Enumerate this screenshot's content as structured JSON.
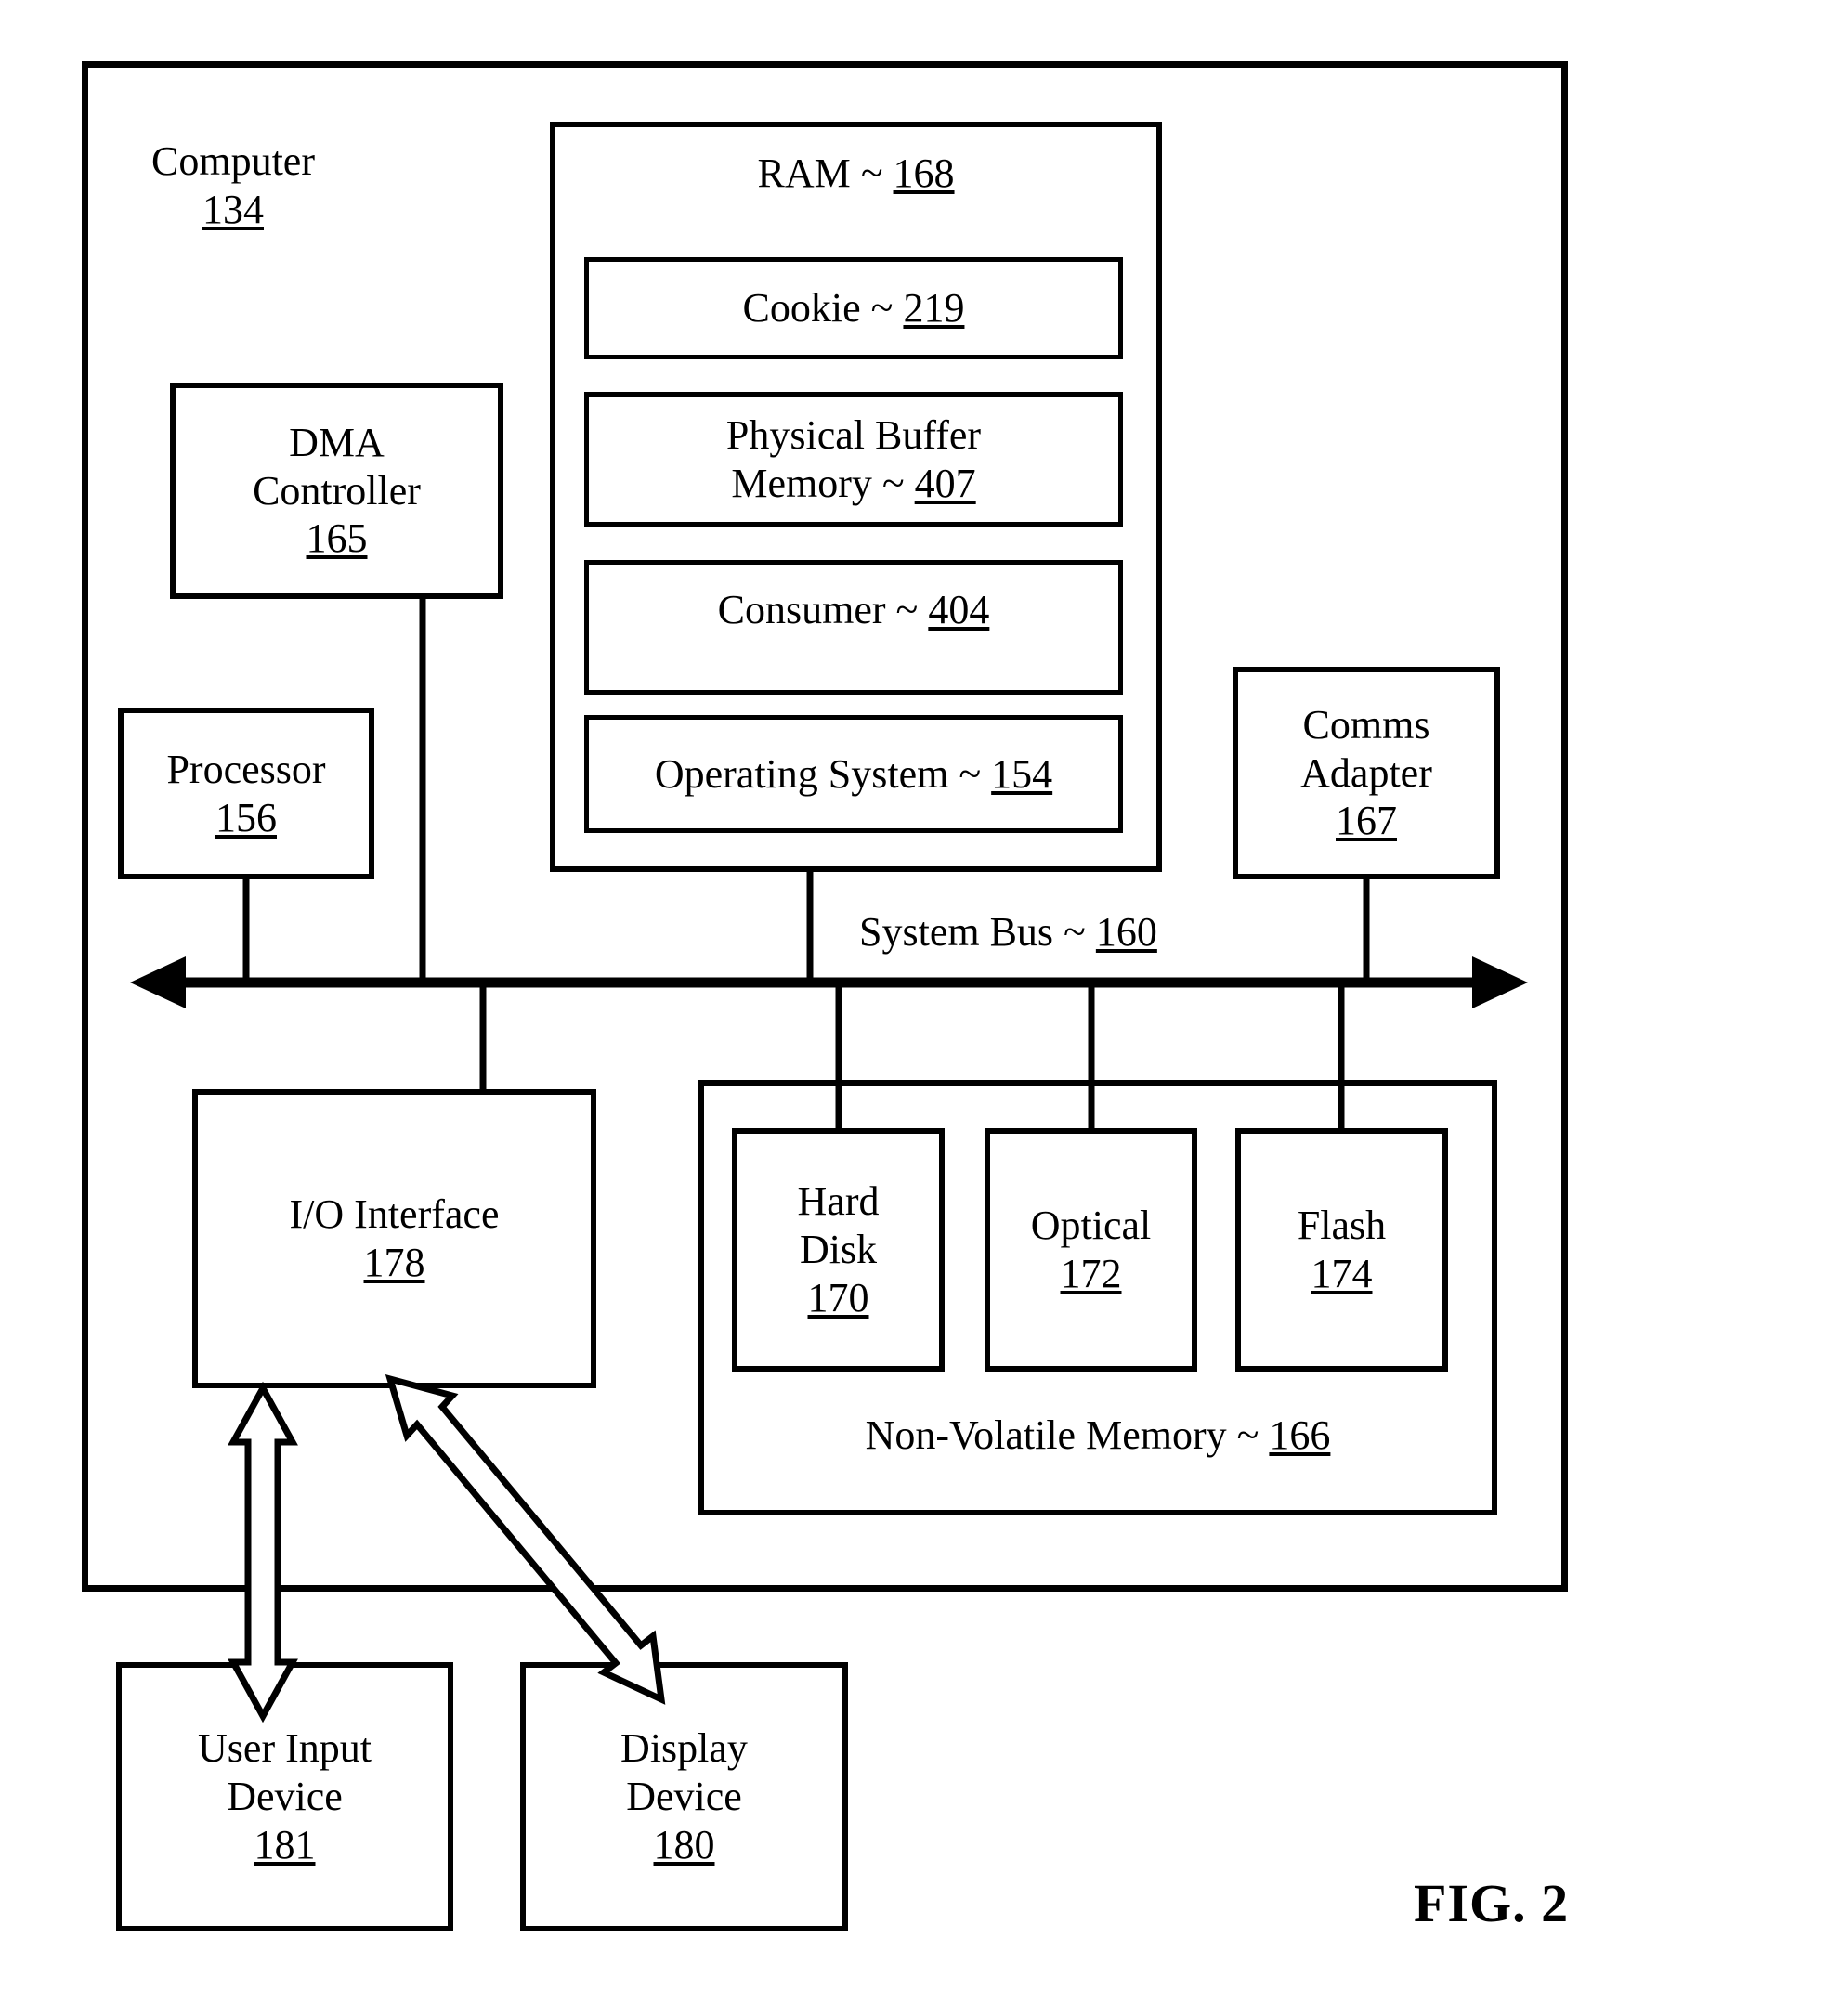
{
  "figure": {
    "label": "FIG. 2",
    "title_block": {
      "name": "Computer",
      "ref": "134"
    }
  },
  "chassis": {
    "name": "computer-chassis"
  },
  "ram": {
    "title_text": "RAM ~ ",
    "title_ref": "168",
    "items": [
      {
        "text": "Cookie ~ ",
        "ref": "219",
        "lines": [
          "Cookie ~ 219"
        ]
      },
      {
        "text": "Physical Buffer",
        "text2": "Memory ~ ",
        "ref": "407"
      },
      {
        "text": "Consumer ~ ",
        "ref": "404"
      },
      {
        "text": "Operating System ~ ",
        "ref": "154"
      }
    ]
  },
  "dma": {
    "line1": "DMA",
    "line2": "Controller",
    "ref": "165"
  },
  "processor": {
    "line1": "Processor",
    "ref": "156"
  },
  "comms": {
    "line1": "Comms",
    "line2": "Adapter",
    "ref": "167"
  },
  "bus": {
    "text": "System Bus ~ ",
    "ref": "160"
  },
  "io": {
    "line1": "I/O Interface",
    "ref": "178"
  },
  "nvm": {
    "text": "Non-Volatile Memory ~ ",
    "ref": "166",
    "drives": [
      {
        "line1": "Hard",
        "line2": "Disk",
        "ref": "170"
      },
      {
        "line1": "Optical",
        "ref": "172"
      },
      {
        "line1": "Flash",
        "ref": "174"
      }
    ]
  },
  "peripherals": [
    {
      "line1": "User Input",
      "line2": "Device",
      "ref": "181"
    },
    {
      "line1": "Display",
      "line2": "Device",
      "ref": "180"
    }
  ],
  "colors": {
    "ink": "#000000",
    "paper": "#ffffff"
  }
}
